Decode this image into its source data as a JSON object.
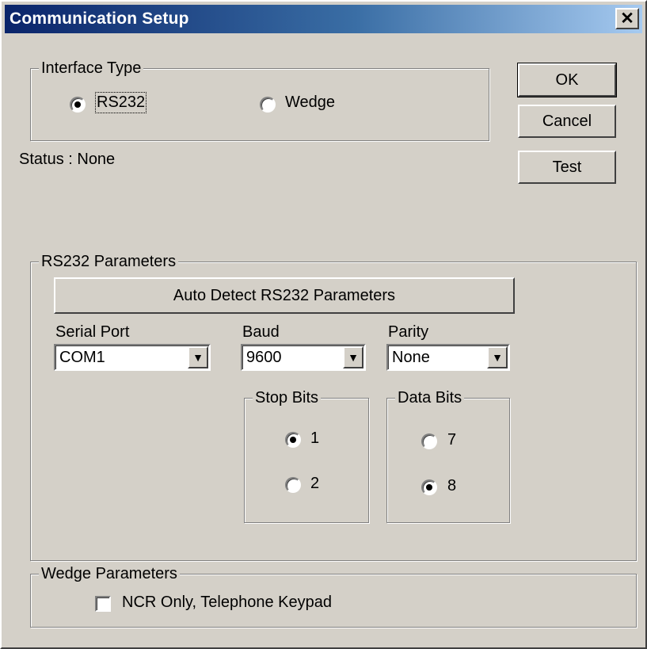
{
  "window": {
    "title": "Communication Setup",
    "close_label": "✕"
  },
  "buttons": {
    "ok": "OK",
    "cancel": "Cancel",
    "test": "Test"
  },
  "interface_type": {
    "label": "Interface Type",
    "options": [
      "RS232",
      "Wedge"
    ],
    "selected": "RS232"
  },
  "status": "Status : None",
  "rs232": {
    "label": "RS232 Parameters",
    "auto_detect": "Auto Detect RS232 Parameters",
    "serial_port": {
      "label": "Serial Port",
      "value": "COM1"
    },
    "baud": {
      "label": "Baud",
      "value": "9600"
    },
    "parity": {
      "label": "Parity",
      "value": "None"
    },
    "stop_bits": {
      "label": "Stop Bits",
      "options": [
        "1",
        "2"
      ],
      "selected": "1"
    },
    "data_bits": {
      "label": "Data Bits",
      "options": [
        "7",
        "8"
      ],
      "selected": "8"
    }
  },
  "wedge": {
    "label": "Wedge Parameters",
    "checkbox_label": "NCR Only, Telephone Keypad",
    "checked": false
  },
  "icons": {
    "dropdown": "▼"
  },
  "colors": {
    "titlebar_start": "#0a246a",
    "titlebar_end": "#a6caf0",
    "face": "#d4d0c8"
  }
}
